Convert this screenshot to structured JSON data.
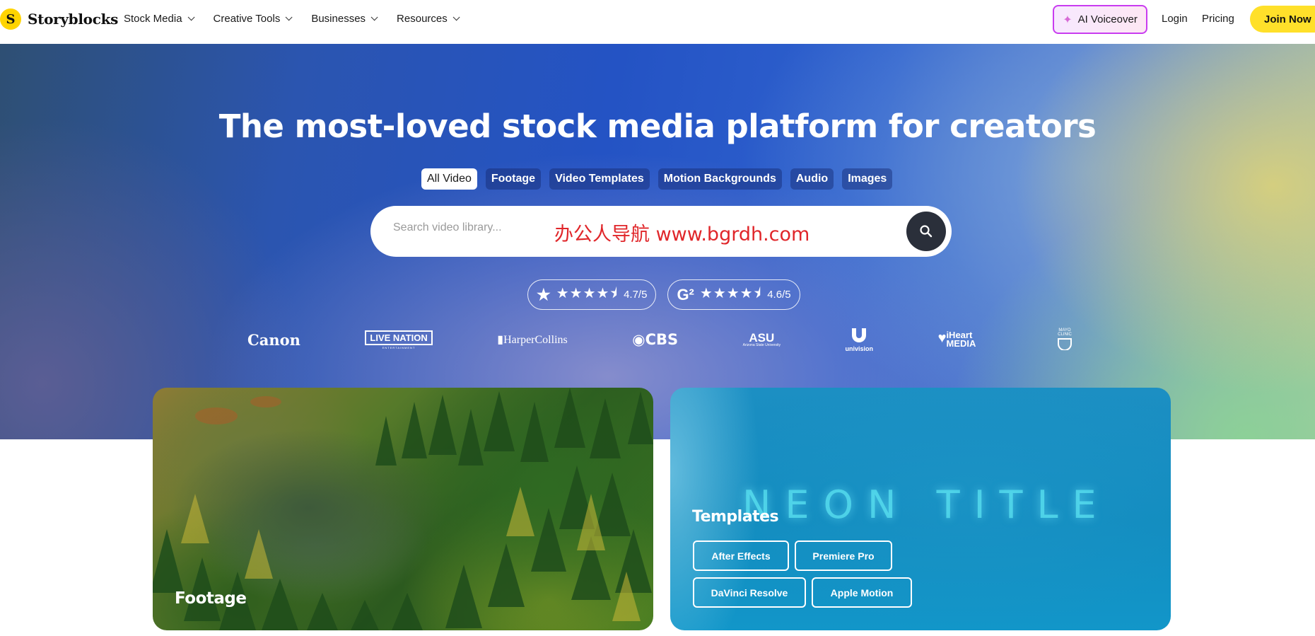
{
  "nav": {
    "logo_mark": "S",
    "logo_text": "Storyblocks",
    "menu": [
      "Stock Media",
      "Creative Tools",
      "Businesses",
      "Resources"
    ],
    "ai_voiceover": "AI Voiceover",
    "login": "Login",
    "pricing": "Pricing",
    "join": "Join Now"
  },
  "hero": {
    "title": "The most-loved stock media platform for creators",
    "chips": [
      "All Video",
      "Footage",
      "Video Templates",
      "Motion Backgrounds",
      "Audio",
      "Images"
    ],
    "active_chip": "All Video",
    "search": {
      "placeholder": "Search video library...",
      "watermark": "办公人导航  www.bgrdh.com"
    },
    "ratings": [
      {
        "icon": "star-icon",
        "score": "4.7/5",
        "stars": 4.5
      },
      {
        "icon": "g2-icon",
        "score": "4.6/5",
        "stars": 4.5
      }
    ],
    "brands": [
      "Canon",
      "LIVE NATION",
      "HarperCollins",
      "CBS",
      "ASU",
      "univision",
      "iHeart MEDIA",
      "MAYO CLINIC"
    ],
    "brand_sub": {
      "live_nation": "ENTERTAINMENT",
      "asu": "Arizona State University"
    }
  },
  "cards": {
    "footage": {
      "label": "Footage"
    },
    "templates": {
      "neon_text": "NEON TITLE",
      "label": "Templates",
      "buttons": [
        "After Effects",
        "Premiere Pro",
        "DaVinci Resolve",
        "Apple Motion"
      ]
    }
  },
  "colors": {
    "accent_yellow": "#ffe02a",
    "ai_border": "#c93cf0",
    "search_button": "#2a2f3a"
  }
}
